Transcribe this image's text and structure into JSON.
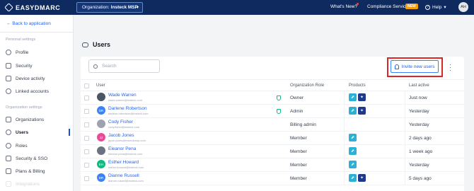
{
  "topbar": {
    "logo": "EASYDMARC",
    "org_prefix": "Organization:",
    "org_name": "Insteck MSP",
    "whats_new": "What's New?",
    "compliance": "Compliance Service",
    "new_badge": "NEW",
    "help": "Help",
    "user_initials": "AH"
  },
  "sidebar": {
    "back": "Back to application",
    "personal_heading": "Personal settings",
    "personal_items": [
      "Profile",
      "Security",
      "Device activity",
      "Linked accounts"
    ],
    "org_heading": "Organization settings",
    "org_items": [
      "Organizations",
      "Users",
      "Roles",
      "Security & SSO",
      "Plans & Billing",
      "Integrations"
    ],
    "active": "Users"
  },
  "page": {
    "title": "Users",
    "search_placeholder": "Search",
    "invite_label": "Invite new users"
  },
  "table": {
    "headers": {
      "user": "User",
      "role": "Organization Role",
      "products": "Products",
      "last_active": "Last active"
    },
    "rows": [
      {
        "name": "Wade Warren",
        "email": "wade.warren@insteck.com",
        "initials": "",
        "avatar_color": "#4b5563",
        "role": "Owner",
        "verified": true,
        "products": [
          "a",
          "b"
        ],
        "last_active": "Just now"
      },
      {
        "name": "Darlene Robertson",
        "email": "darlene.robertson@insteck.com",
        "initials": "DR",
        "avatar_color": "#3b82f6",
        "role": "Admin",
        "verified": true,
        "products": [
          "a",
          "b"
        ],
        "last_active": "Yesterday"
      },
      {
        "name": "Cody Fisher",
        "email": "cody.fisher@insteck.com",
        "initials": "",
        "avatar_color": "#9ca3af",
        "role": "Billing admin",
        "verified": false,
        "products": [],
        "last_active": "Yesterday"
      },
      {
        "name": "Jacob Jones",
        "email": "jacob.jones@insteckmsp.com",
        "initials": "JJ",
        "avatar_color": "#ec4899",
        "role": "Member",
        "verified": false,
        "products": [
          "a"
        ],
        "last_active": "2 days ago"
      },
      {
        "name": "Eleanor Pena",
        "email": "eleanor.pena@insteck.com",
        "initials": "",
        "avatar_color": "#6b7280",
        "role": "Member",
        "verified": false,
        "products": [
          "a"
        ],
        "last_active": "1 week ago"
      },
      {
        "name": "Esther Howard",
        "email": "esther.howard@insteck.com",
        "initials": "EH",
        "avatar_color": "#10b981",
        "role": "Member",
        "verified": false,
        "products": [
          "a"
        ],
        "last_active": "Yesterday"
      },
      {
        "name": "Dianne Russell",
        "email": "dianne.russell@insteck.com",
        "initials": "DR",
        "avatar_color": "#3b82f6",
        "role": "Member",
        "verified": false,
        "products": [
          "a",
          "b"
        ],
        "last_active": "5 days ago"
      }
    ]
  },
  "colors": {
    "topbar": "#0f2a5f",
    "accent": "#2563eb",
    "highlight": "#dc2626"
  }
}
